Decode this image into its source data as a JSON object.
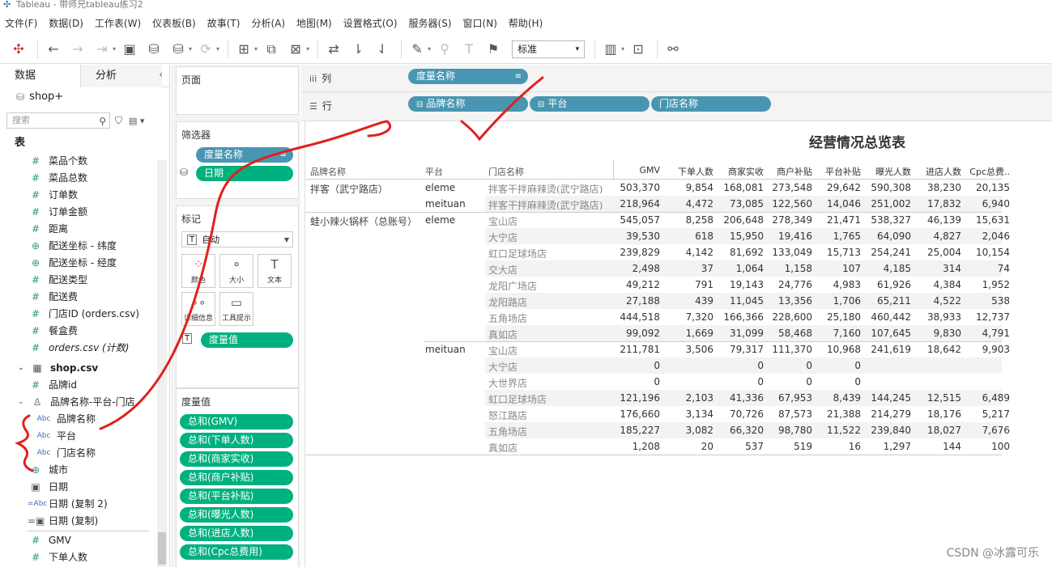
{
  "window": {
    "title": "Tableau - 带师兄tableau练习2"
  },
  "menu": [
    "文件(F)",
    "数据(D)",
    "工作表(W)",
    "仪表板(B)",
    "故事(T)",
    "分析(A)",
    "地图(M)",
    "设置格式(O)",
    "服务器(S)",
    "窗口(N)",
    "帮助(H)"
  ],
  "toolbar": {
    "view_mode": "标准"
  },
  "data_pane": {
    "tabs": [
      "数据",
      "分析"
    ],
    "source": "shop+",
    "search_placeholder": "搜索",
    "tables_header": "表",
    "orders_fields": [
      "菜品个数",
      "菜品总数",
      "订单数",
      "订单金额",
      "距离",
      "配送坐标 - 纬度",
      "配送坐标 - 经度",
      "配送类型",
      "配送费",
      "门店ID (orders.csv)",
      "餐盒费",
      "orders.csv (计数)"
    ],
    "shop_table": "shop.csv",
    "shop_fields_top": [
      "品牌id"
    ],
    "hierarchy": "品牌名称-平台-门店",
    "hierarchy_fields": [
      "品牌名称",
      "平台",
      "门店名称"
    ],
    "shop_fields_bottom": [
      "城市",
      "日期",
      "日期 (复制 2)",
      "日期 (复制)"
    ],
    "measures": [
      "GMV",
      "下单人数"
    ]
  },
  "shelves": {
    "pages_title": "页面",
    "filters_title": "筛选器",
    "filters": [
      "度量名称",
      "日期"
    ],
    "marks_title": "标记",
    "mark_type": "自动",
    "mark_buttons": [
      "颜色",
      "大小",
      "文本",
      "详细信息",
      "工具提示"
    ],
    "mark_pill": "度量值",
    "measure_values_title": "度量值",
    "measure_values": [
      "总和(GMV)",
      "总和(下单人数)",
      "总和(商家实收)",
      "总和(商户补贴)",
      "总和(平台补贴)",
      "总和(曝光人数)",
      "总和(进店人数)",
      "总和(Cpc总费用)"
    ],
    "columns_label": "列",
    "columns": [
      "度量名称"
    ],
    "rows_label": "行",
    "rows": [
      "品牌名称",
      "平台",
      "门店名称"
    ]
  },
  "viz": {
    "title": "经营情况总览表",
    "row_headers": [
      "品牌名称",
      "平台",
      "门店名称"
    ],
    "col_headers": [
      "GMV",
      "下单人数",
      "商家实收",
      "商户补贴",
      "平台补贴",
      "曝光人数",
      "进店人数",
      "Cpc总费.."
    ],
    "brand1": "拌客（武宁路店）",
    "brand2": "蛙小辣火锅杯（总账号）",
    "rows": [
      {
        "platform": "eleme",
        "store": "拌客干拌麻辣烫(武宁路店)",
        "v": [
          "503,370",
          "9,854",
          "168,081",
          "273,548",
          "29,642",
          "590,308",
          "38,230",
          "20,135"
        ]
      },
      {
        "platform": "meituan",
        "store": "拌客干拌麻辣烫(武宁路店)",
        "v": [
          "218,964",
          "4,472",
          "73,085",
          "122,560",
          "14,046",
          "251,002",
          "17,832",
          "6,940"
        ]
      },
      {
        "platform": "eleme",
        "store": "宝山店",
        "v": [
          "545,057",
          "8,258",
          "206,648",
          "278,349",
          "21,471",
          "538,327",
          "46,139",
          "15,631"
        ]
      },
      {
        "platform": "",
        "store": "大宁店",
        "v": [
          "39,530",
          "618",
          "15,950",
          "19,416",
          "1,765",
          "64,090",
          "4,827",
          "2,046"
        ]
      },
      {
        "platform": "",
        "store": "虹口足球场店",
        "v": [
          "239,829",
          "4,142",
          "81,692",
          "133,049",
          "15,713",
          "254,241",
          "25,004",
          "10,154"
        ]
      },
      {
        "platform": "",
        "store": "交大店",
        "v": [
          "2,498",
          "37",
          "1,064",
          "1,158",
          "107",
          "4,185",
          "314",
          "74"
        ]
      },
      {
        "platform": "",
        "store": "龙阳广场店",
        "v": [
          "49,212",
          "791",
          "19,143",
          "24,776",
          "4,983",
          "61,926",
          "4,384",
          "1,952"
        ]
      },
      {
        "platform": "",
        "store": "龙阳路店",
        "v": [
          "27,188",
          "439",
          "11,045",
          "13,356",
          "1,706",
          "65,211",
          "4,522",
          "538"
        ]
      },
      {
        "platform": "",
        "store": "五角场店",
        "v": [
          "444,518",
          "7,320",
          "166,366",
          "228,600",
          "25,180",
          "460,442",
          "38,933",
          "12,737"
        ]
      },
      {
        "platform": "",
        "store": "真如店",
        "v": [
          "99,092",
          "1,669",
          "31,099",
          "58,468",
          "7,160",
          "107,645",
          "9,830",
          "4,791"
        ]
      },
      {
        "platform": "meituan",
        "store": "宝山店",
        "v": [
          "211,781",
          "3,506",
          "79,317",
          "111,370",
          "10,968",
          "241,619",
          "18,642",
          "9,903"
        ]
      },
      {
        "platform": "",
        "store": "大宁店",
        "v": [
          "0",
          "",
          "0",
          "0",
          "0",
          "",
          "",
          ""
        ]
      },
      {
        "platform": "",
        "store": "大世界店",
        "v": [
          "0",
          "",
          "0",
          "0",
          "0",
          "",
          "",
          ""
        ]
      },
      {
        "platform": "",
        "store": "虹口足球场店",
        "v": [
          "121,196",
          "2,103",
          "41,336",
          "67,953",
          "8,439",
          "144,245",
          "12,515",
          "6,489"
        ]
      },
      {
        "platform": "",
        "store": "怒江路店",
        "v": [
          "176,660",
          "3,134",
          "70,726",
          "87,573",
          "21,388",
          "214,279",
          "18,176",
          "5,217"
        ]
      },
      {
        "platform": "",
        "store": "五角场店",
        "v": [
          "185,227",
          "3,082",
          "66,320",
          "98,780",
          "11,522",
          "239,840",
          "18,027",
          "7,676"
        ]
      },
      {
        "platform": "",
        "store": "真如店",
        "v": [
          "1,208",
          "20",
          "537",
          "519",
          "16",
          "1,297",
          "144",
          "100"
        ]
      }
    ]
  },
  "watermark": "CSDN @冰露可乐",
  "colors": {
    "pill_blue": "#4996b2",
    "pill_green": "#00b180",
    "annotation_red": "#e0201b"
  }
}
